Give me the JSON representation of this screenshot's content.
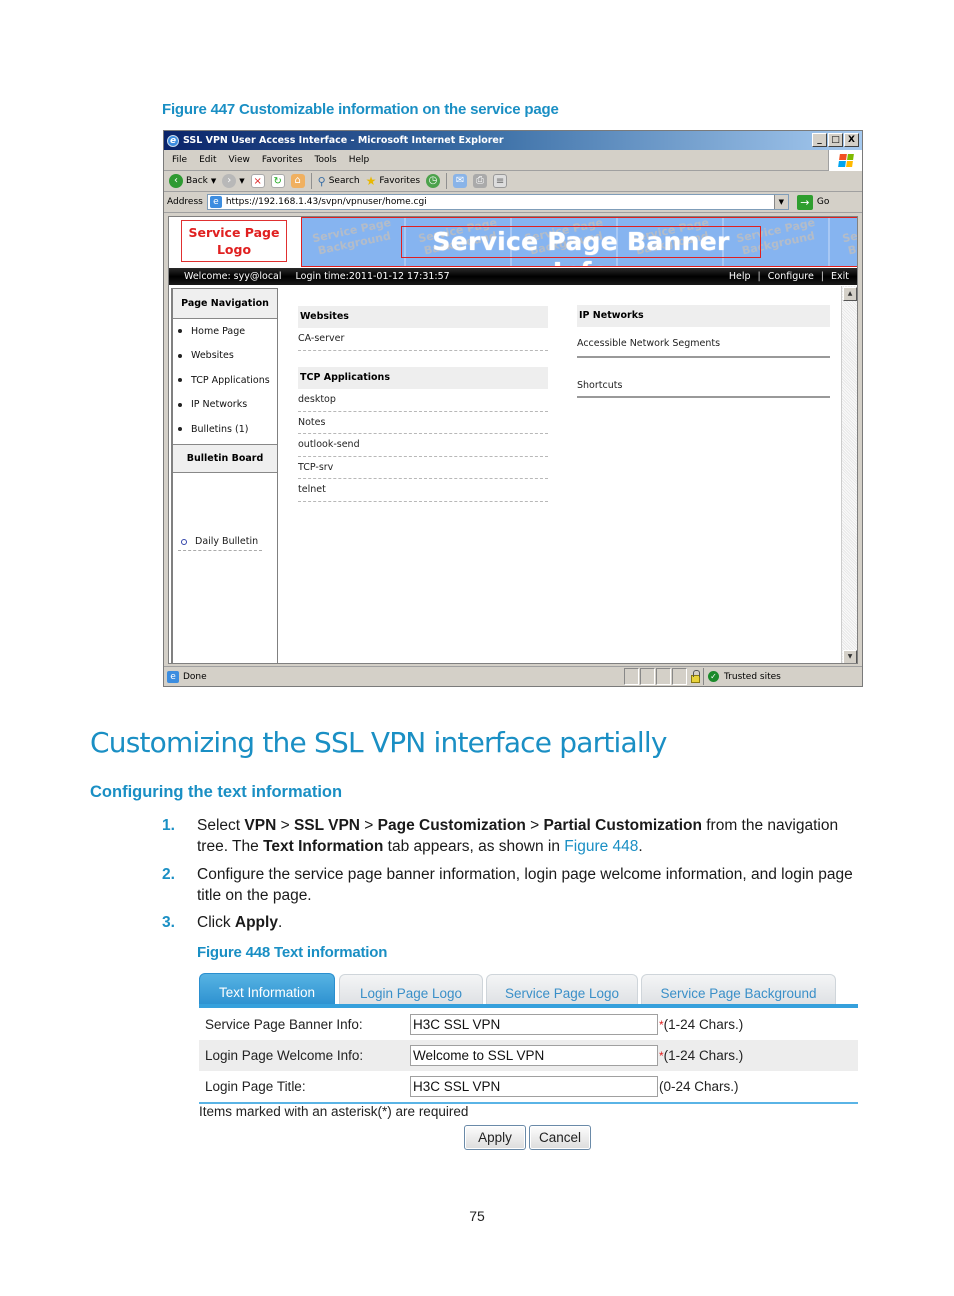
{
  "figure447": {
    "caption": "Figure 447 Customizable information on the service page",
    "window": {
      "title": "SSL VPN User Access Interface - Microsoft Internet Explorer",
      "controls": [
        "_",
        "□",
        "X"
      ],
      "menu": [
        "File",
        "Edit",
        "View",
        "Favorites",
        "Tools",
        "Help"
      ],
      "toolbar": {
        "back": "Back",
        "search": "Search",
        "favorites": "Favorites"
      },
      "address_label": "Address",
      "url": "https://192.168.1.43/svpn/vpnuser/home.cgi",
      "go_label": "Go",
      "status": {
        "left": "Done",
        "zone": "Trusted sites"
      }
    },
    "page": {
      "logo_text": "Service Page Logo",
      "background_tile": "Service Page Background",
      "banner_info": "Service Page Banner Info",
      "welcome": "Welcome: syy@local",
      "login_time": "Login time:2011-01-12 17:31:57",
      "top_links": [
        "Help",
        "Configure",
        "Exit"
      ],
      "nav": {
        "header": "Page Navigation",
        "items": [
          "Home Page",
          "Websites",
          "TCP Applications",
          "IP Networks",
          "Bulletins (1)"
        ],
        "bulletin_header": "Bulletin Board",
        "bulletin_item": "Daily Bulletin"
      },
      "websites": {
        "header": "Websites",
        "items": [
          "CA-server"
        ]
      },
      "tcp_apps": {
        "header": "TCP Applications",
        "items": [
          "desktop",
          "Notes",
          "outlook-send",
          "TCP-srv",
          "telnet"
        ]
      },
      "ip_networks": {
        "header": "IP Networks",
        "items": [
          "Accessible Network Segments",
          "Shortcuts"
        ]
      }
    }
  },
  "section": {
    "title": "Customizing the SSL VPN interface partially",
    "subtitle": "Configuring the text information",
    "steps": [
      {
        "num": "1.",
        "parts": {
          "a": "Select ",
          "b1": "VPN",
          "c": " > ",
          "b2": "SSL VPN",
          "d": " > ",
          "b3": "Page Customization",
          "e": " > ",
          "b4": "Partial Customization",
          "f": " from the navigation tree. The ",
          "b5": "Text Information",
          "g": " tab appears, as shown in ",
          "link": "Figure 448",
          "h": "."
        }
      },
      {
        "num": "2.",
        "text": "Configure the service page banner information, login page welcome information, and login page title on the page."
      },
      {
        "num": "3.",
        "parts": {
          "a": "Click ",
          "b": "Apply",
          "c": "."
        }
      }
    ]
  },
  "figure448": {
    "caption": "Figure 448 Text information",
    "tabs": [
      {
        "label": "Text Information",
        "active": true
      },
      {
        "label": "Login Page Logo",
        "active": false
      },
      {
        "label": "Service Page Logo",
        "active": false
      },
      {
        "label": "Service Page Background",
        "active": false
      }
    ],
    "fields": [
      {
        "label": "Service Page Banner Info:",
        "value": "H3C SSL VPN",
        "required": "*",
        "hint": "(1-24 Chars.)"
      },
      {
        "label": "Login Page Welcome Info:",
        "value": "Welcome to SSL VPN",
        "required": "*",
        "hint": "(1-24 Chars.)"
      },
      {
        "label": "Login Page Title:",
        "value": "H3C SSL VPN",
        "required": "",
        "hint": "(0-24 Chars.)"
      }
    ],
    "required_note": "Items marked with an asterisk(*) are required",
    "buttons": {
      "apply": "Apply",
      "cancel": "Cancel"
    }
  },
  "page_number": "75",
  "colors": {
    "accent": "#1a8fc4",
    "tab_active": "#2a8fcf",
    "required": "#e02020",
    "banner_bg": "#86b4f0"
  }
}
